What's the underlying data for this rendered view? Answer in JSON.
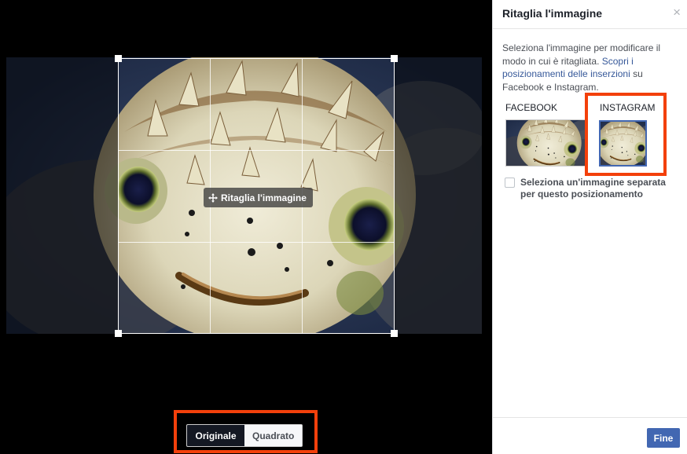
{
  "editor": {
    "move_label": "Ritaglia l'immagine",
    "ratio_options": [
      "Originale",
      "Quadrato"
    ],
    "selected_ratio": "Originale"
  },
  "panel": {
    "title": "Ritaglia l'immagine",
    "close": "×",
    "desc_pre": "Seleziona l'immagine per modificare il modo in cui è ritagliata. ",
    "desc_link": "Scopri i posizionamenti delle inserzioni",
    "desc_post": " su Facebook e Instagram.",
    "placements": [
      "FACEBOOK",
      "INSTAGRAM"
    ],
    "selected_placement": "INSTAGRAM",
    "checkbox_label": "Seleziona un'immagine separata per questo posizionamento",
    "checkbox_checked": false,
    "done_label": "Fine"
  },
  "colors": {
    "highlight": "#f3400b",
    "primary": "#4267b2",
    "link": "#365899"
  },
  "icons": {
    "move": "move-arrows-icon",
    "close": "close-icon"
  }
}
